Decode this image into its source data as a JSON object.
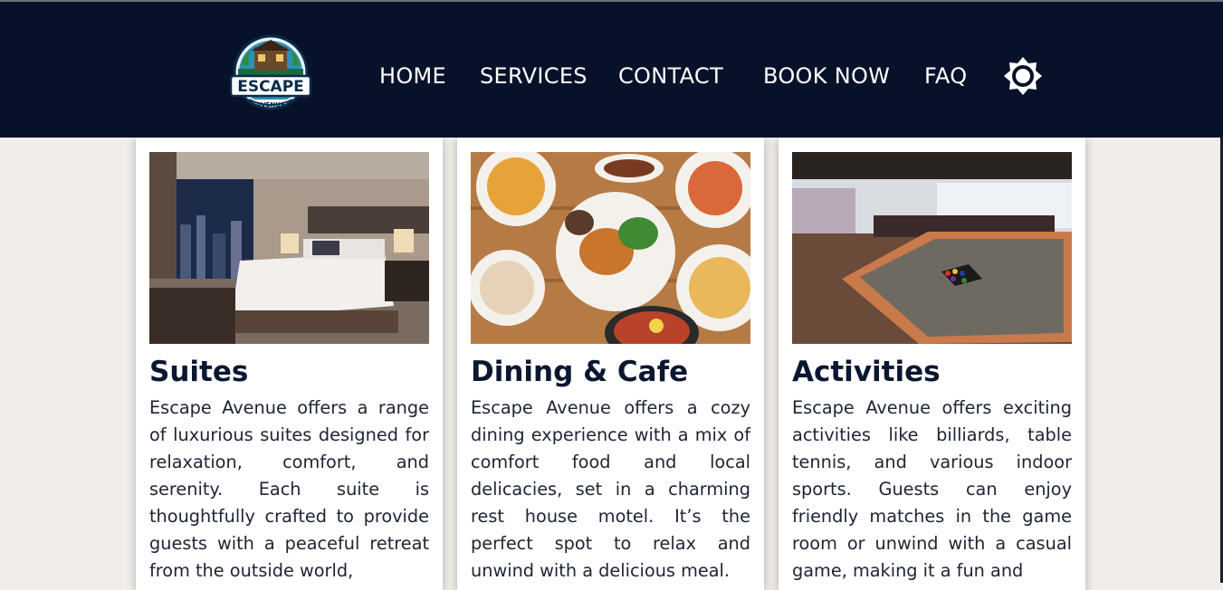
{
  "nav": {
    "logo_top": "ESCAPE",
    "logo_bottom": "AVENUE",
    "items": [
      "HOME",
      "SERVICES",
      "CONTACT",
      "BOOK NOW",
      "FAQ"
    ]
  },
  "theme_icon": "sun-icon",
  "colors": {
    "header_bg": "#07122a",
    "page_bg": "#f1eeea",
    "card_bg": "#ffffff",
    "title": "#0b1630"
  },
  "cards": [
    {
      "title": "Suites",
      "image": "hotel-suite-bedroom-photo",
      "text": "Escape Avenue offers a range of luxurious suites designed for relaxation, comfort, and serenity. Each suite is thoughtfully crafted to provide guests with a peaceful retreat from the outside world,"
    },
    {
      "title": "Dining & Cafe",
      "image": "dining-food-spread-photo",
      "text": "Escape Avenue offers a cozy dining experience with a mix of comfort food and local delicacies, set in a charming rest house motel. It’s the perfect spot to relax and unwind with a delicious meal."
    },
    {
      "title": "Activities",
      "image": "billiards-game-room-photo",
      "text": "Escape Avenue offers exciting activities like billiards, table tennis, and various indoor sports. Guests can enjoy friendly matches in the game room or unwind with a casual game, making it a fun and"
    }
  ]
}
